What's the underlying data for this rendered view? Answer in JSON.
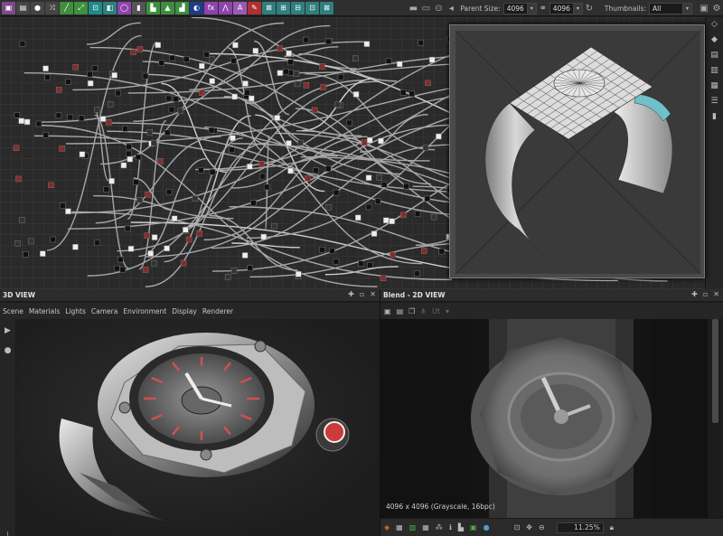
{
  "toolbar": {
    "icons": [
      "image-icon",
      "layers-icon",
      "drop-icon",
      "shuffle-icon",
      "gradient-icon",
      "transform-icon",
      "crop-icon",
      "blend-icon",
      "palette-icon",
      "node-icon",
      "level-icon",
      "sharpen-icon",
      "hsl-icon",
      "curve-icon",
      "fx-icon",
      "height-icon",
      "text-icon",
      "pin-icon",
      "grid-icon",
      "grid2-icon",
      "grid3-icon"
    ],
    "parent_size_label": "Parent Size:",
    "width_value": "4096",
    "height_value": "4096",
    "thumbnails_label": "Thumbnails:",
    "thumbnails_value": "All"
  },
  "view3d": {
    "title": "3D VIEW",
    "menu": [
      "Scene",
      "Materials",
      "Lights",
      "Camera",
      "Environment",
      "Display",
      "Renderer"
    ]
  },
  "view2d": {
    "title": "Blend - 2D VIEW",
    "toolbar_muted": "Ut",
    "info": "4096 x 4096 (Grayscale, 16bpc)",
    "zoom": "11.25%"
  },
  "colors": {
    "accent_green": "#4caf50",
    "accent_purple": "#8e44ad",
    "accent_teal": "#1f8a8a"
  }
}
